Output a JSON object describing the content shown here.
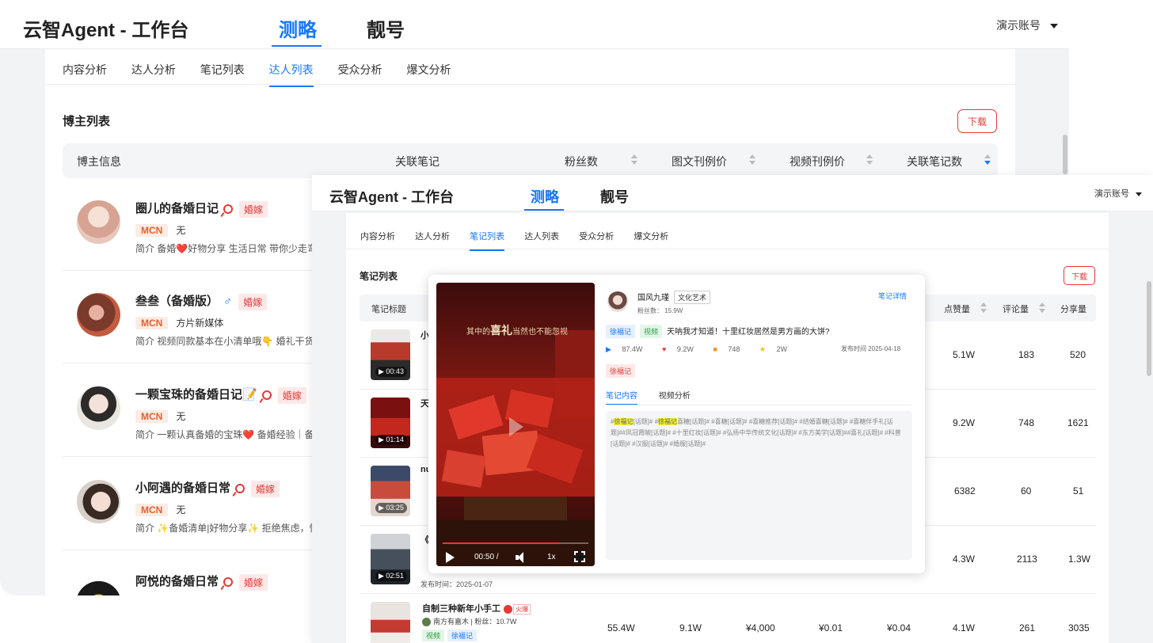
{
  "colors": {
    "accent": "#1677ff",
    "danger": "#e53935",
    "mcn": "#e8602c"
  },
  "back_window": {
    "app_title": "云智Agent - 工作台",
    "top_tabs": [
      "测略",
      "靓号"
    ],
    "account": "演示账号",
    "sub_tabs": [
      "内容分析",
      "达人分析",
      "笔记列表",
      "达人列表",
      "受众分析",
      "爆文分析"
    ],
    "active_sub_tab": "达人列表",
    "section_title": "博主列表",
    "download_label": "下载",
    "columns": [
      "博主信息",
      "关联笔记",
      "粉丝数",
      "图文刊例价",
      "视频刊例价",
      "关联笔记数"
    ],
    "bloggers": [
      {
        "name": "圈儿的备婚日记",
        "gender_icon": "female-icon",
        "tag": "婚嫁",
        "mcn_label": "MCN",
        "mcn": "无",
        "intro": "简介  备婚❤️好物分享  生活日常  带你少走弯路"
      },
      {
        "name": "叁叁（备婚版）",
        "gender_icon": "male-icon",
        "tag": "婚嫁",
        "mcn_label": "MCN",
        "mcn": "方片新媒体",
        "intro": "简介  视频同款基本在小清单哦👇  婚礼干货 | 好"
      },
      {
        "name": "一颗宝珠的备婚日记📝",
        "gender_icon": "female-icon",
        "tag": "婚嫁",
        "mcn_label": "MCN",
        "mcn": "无",
        "intro": "简介  一颗认真备婚的宝珠❤️  备婚经验｜备婚"
      },
      {
        "name": "小阿遇的备婚日常",
        "gender_icon": "female-icon",
        "tag": "婚嫁",
        "mcn_label": "MCN",
        "mcn": "无",
        "intro": "简介  ✨备婚清单|好物分享✨  拒绝焦虑，快乐"
      },
      {
        "name": "阿悦的备婚日常",
        "gender_icon": "female-icon",
        "tag": "婚嫁",
        "mcn_label": "",
        "mcn": "",
        "intro": ""
      }
    ]
  },
  "mid_window": {
    "app_title": "云智Agent - 工作台",
    "top_tabs": [
      "测略",
      "靓号"
    ],
    "account": "演示账号",
    "sub_tabs": [
      "内容分析",
      "达人分析",
      "笔记列表",
      "达人列表",
      "受众分析",
      "爆文分析"
    ],
    "active_sub_tab": "笔记列表",
    "section_title": "笔记列表",
    "download_label": "下载",
    "columns": [
      "笔记标题",
      "点赞量",
      "评论量",
      "分享量"
    ],
    "notes": [
      {
        "duration": "00:43",
        "title_frag": "小",
        "likes": "5.1W",
        "comments": "183",
        "shares": "520"
      },
      {
        "duration": "01:14",
        "title_frag": "天",
        "likes": "9.2W",
        "comments": "748",
        "shares": "1621"
      },
      {
        "duration": "03:25",
        "title_frag": "nu",
        "likes": "6382",
        "comments": "60",
        "shares": "51"
      },
      {
        "duration": "02:51",
        "title_frag": "《",
        "likes": "4.3W",
        "comments": "2113",
        "shares": "1.3W",
        "pub_time": "发布时间：2025-01-07"
      },
      {
        "duration": "",
        "title": "自制三种新年小手工",
        "hot_label": "火爆",
        "author": "南方有嘉木",
        "fans": "粉丝：10.7W",
        "tag_green": "视频",
        "tag_blue": "徐福记",
        "plays": "55.4W",
        "collects": "9.1W",
        "price_img": "¥4,000",
        "cpm": "¥0.01",
        "cpe": "¥0.04",
        "likes": "4.1W",
        "comments": "261",
        "shares": "3035"
      }
    ]
  },
  "popup": {
    "video_caption_a": "其中的",
    "video_caption_b": "喜礼",
    "video_caption_c": "当然也不能忽视",
    "video_time": "00:50 /",
    "video_speed": "1x",
    "video_progress": 0.8,
    "author": "国风九瑾",
    "category": "文化艺术",
    "fans": "粉丝数：  15.9W",
    "detail_link": "笔记详情",
    "brand_tag": "徐福记",
    "type_tag": "视频",
    "title": "天呐我才知道！十里红妆居然是男方画的大饼?",
    "stats": {
      "plays": "87.4W",
      "likes": "9.2W",
      "comments": "748",
      "collects": "2W"
    },
    "pub_time": "发布时间 2025-04-18",
    "red_tag": "徐福记",
    "tabs": [
      "笔记内容",
      "视频分析"
    ],
    "content_parts": [
      {
        "t": "#",
        "hl": false
      },
      {
        "t": "徐福记",
        "hl": true
      },
      {
        "t": "[话题]# #",
        "hl": false
      },
      {
        "t": "徐福记",
        "hl": true
      },
      {
        "t": "喜糖[话题]# #喜糖[话题]# #喜糖推荐[话题]# #结婚喜糖[话题]# #喜糖伴手礼[话题]##凤冠霞帔[话题]# #十里红妆[话题]# #弘扬中华传统文化[话题]# #东方美学[话题]##喜礼[话题]# #科普[话题]# #汉服[话题]# #婚服[话题]#",
        "hl": false
      }
    ]
  }
}
